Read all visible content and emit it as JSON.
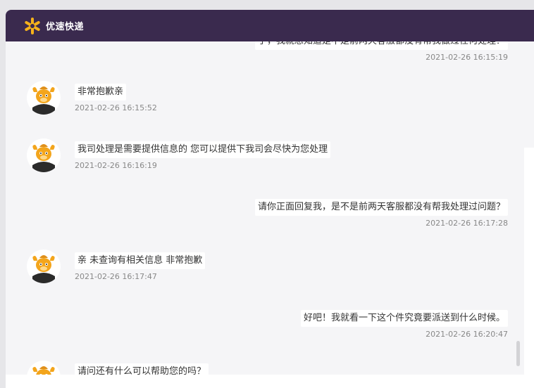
{
  "app": {
    "brand": "优速快递",
    "accent": "#3a2a4e"
  },
  "messages": [
    {
      "side": "right",
      "text": "了，我就想知道是不是前两天客服都没有帮我做过任何处理？",
      "time": "2021-02-26 16:15:19"
    },
    {
      "side": "left",
      "text": "非常抱歉亲",
      "time": "2021-02-26 16:15:52"
    },
    {
      "side": "left",
      "text": "我司处理是需要提供信息的 您可以提供下我司会尽快为您处理",
      "time": "2021-02-26 16:16:19"
    },
    {
      "side": "right",
      "text": "请你正面回复我，是不是前两天客服都没有帮我处理过问题？",
      "time": "2021-02-26 16:17:28"
    },
    {
      "side": "left",
      "text": "亲 未查询有相关信息 非常抱歉",
      "time": "2021-02-26 16:17:47"
    },
    {
      "side": "right",
      "text": "好吧！我就看一下这个件究竟要派送到什么时候。",
      "time": "2021-02-26 16:20:47"
    },
    {
      "side": "left",
      "text": "请问还有什么可以帮助您的吗？",
      "time": ""
    }
  ]
}
